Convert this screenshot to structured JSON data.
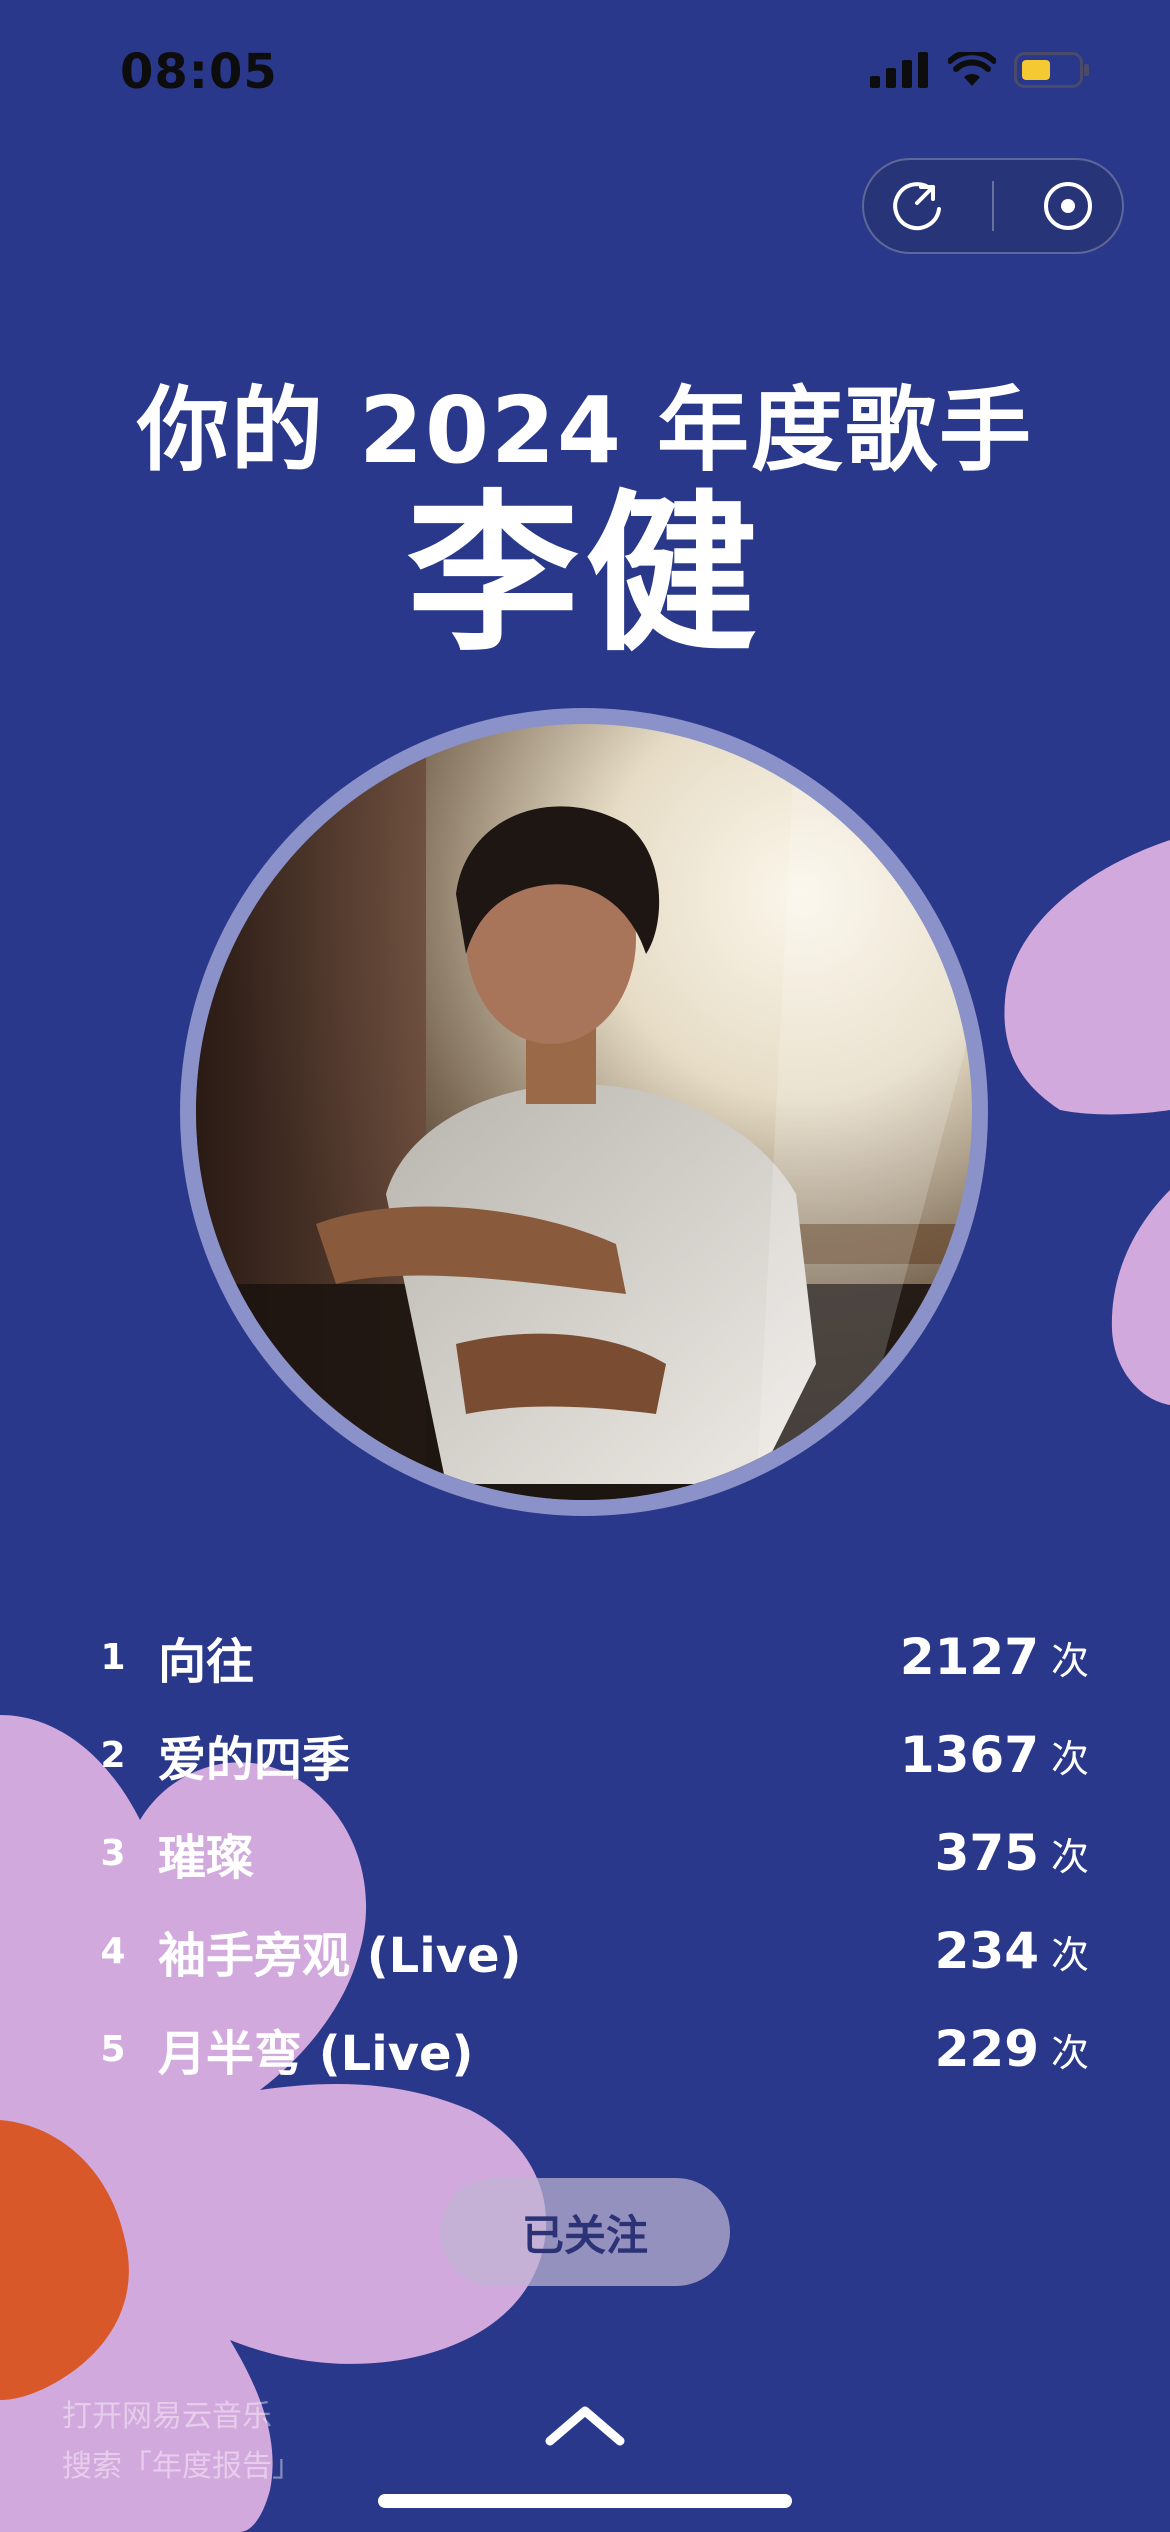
{
  "status_bar": {
    "time": "08:05",
    "icons": [
      "signal-icon",
      "wifi-icon",
      "battery-icon"
    ],
    "battery_color": "#f5c932"
  },
  "capsule": {
    "icons": [
      "share-icon",
      "close-target-icon"
    ]
  },
  "report": {
    "title": "你的 2024 年度歌手",
    "artist": "李健"
  },
  "top_songs": [
    {
      "rank": "1",
      "title": "向往",
      "count": "2127",
      "unit": "次"
    },
    {
      "rank": "2",
      "title": "爱的四季",
      "count": "1367",
      "unit": "次"
    },
    {
      "rank": "3",
      "title": "璀璨",
      "count": "375",
      "unit": "次"
    },
    {
      "rank": "4",
      "title": "袖手旁观 (Live)",
      "count": "234",
      "unit": "次"
    },
    {
      "rank": "5",
      "title": "月半弯 (Live)",
      "count": "229",
      "unit": "次"
    }
  ],
  "follow_button": {
    "label": "已关注"
  },
  "hint": {
    "line1": "打开网易云音乐",
    "line2": "搜索「年度报告」"
  },
  "colors": {
    "background": "#29388a",
    "flower": "#d2a9dc",
    "flower_accent": "#d9582a"
  }
}
